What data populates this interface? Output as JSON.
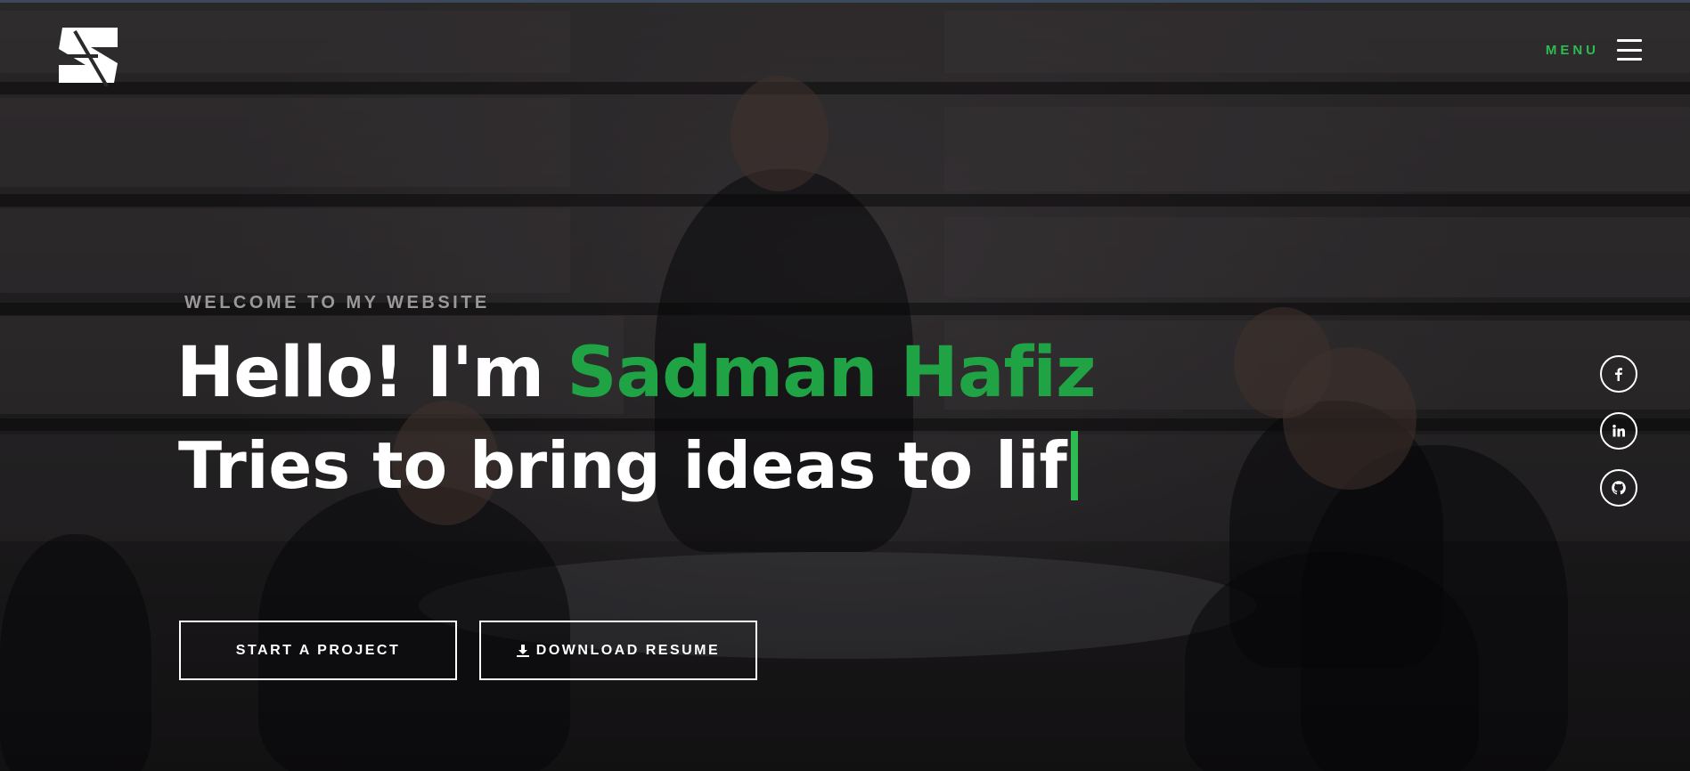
{
  "header": {
    "logo_icon": "stylized-s-logo-icon",
    "menu_label": "MENU",
    "menu_icon": "hamburger-icon"
  },
  "hero": {
    "welcome": "WELCOME TO MY WEBSITE",
    "greeting": "Hello! I'm ",
    "name": "Sadman Hafiz",
    "tagline": "Tries to bring ideas to lif"
  },
  "buttons": {
    "start_project": "START A PROJECT",
    "download_resume": "DOWNLOAD RESUME",
    "download_icon": "download-icon"
  },
  "social": {
    "facebook_icon": "facebook-icon",
    "linkedin_icon": "linkedin-icon",
    "github_icon": "github-icon"
  },
  "colors": {
    "accent": "#2dbb52",
    "name": "#1fa345",
    "text": "#ffffff",
    "welcome": "#9a9899"
  }
}
